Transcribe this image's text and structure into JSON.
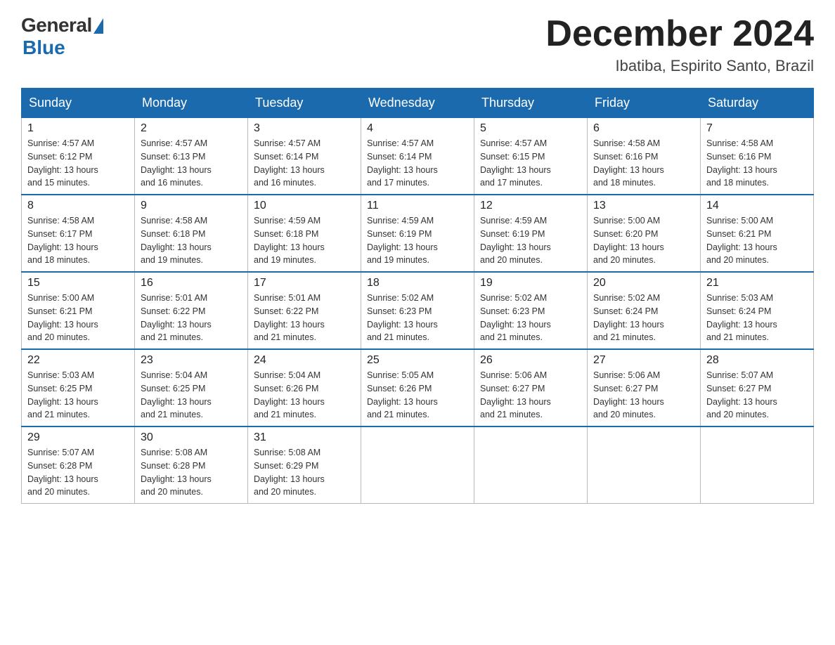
{
  "header": {
    "logo_general": "General",
    "logo_blue": "Blue",
    "month_year": "December 2024",
    "location": "Ibatiba, Espirito Santo, Brazil"
  },
  "days_of_week": [
    "Sunday",
    "Monday",
    "Tuesday",
    "Wednesday",
    "Thursday",
    "Friday",
    "Saturday"
  ],
  "weeks": [
    [
      {
        "day": "1",
        "info": "Sunrise: 4:57 AM\nSunset: 6:12 PM\nDaylight: 13 hours\nand 15 minutes."
      },
      {
        "day": "2",
        "info": "Sunrise: 4:57 AM\nSunset: 6:13 PM\nDaylight: 13 hours\nand 16 minutes."
      },
      {
        "day": "3",
        "info": "Sunrise: 4:57 AM\nSunset: 6:14 PM\nDaylight: 13 hours\nand 16 minutes."
      },
      {
        "day": "4",
        "info": "Sunrise: 4:57 AM\nSunset: 6:14 PM\nDaylight: 13 hours\nand 17 minutes."
      },
      {
        "day": "5",
        "info": "Sunrise: 4:57 AM\nSunset: 6:15 PM\nDaylight: 13 hours\nand 17 minutes."
      },
      {
        "day": "6",
        "info": "Sunrise: 4:58 AM\nSunset: 6:16 PM\nDaylight: 13 hours\nand 18 minutes."
      },
      {
        "day": "7",
        "info": "Sunrise: 4:58 AM\nSunset: 6:16 PM\nDaylight: 13 hours\nand 18 minutes."
      }
    ],
    [
      {
        "day": "8",
        "info": "Sunrise: 4:58 AM\nSunset: 6:17 PM\nDaylight: 13 hours\nand 18 minutes."
      },
      {
        "day": "9",
        "info": "Sunrise: 4:58 AM\nSunset: 6:18 PM\nDaylight: 13 hours\nand 19 minutes."
      },
      {
        "day": "10",
        "info": "Sunrise: 4:59 AM\nSunset: 6:18 PM\nDaylight: 13 hours\nand 19 minutes."
      },
      {
        "day": "11",
        "info": "Sunrise: 4:59 AM\nSunset: 6:19 PM\nDaylight: 13 hours\nand 19 minutes."
      },
      {
        "day": "12",
        "info": "Sunrise: 4:59 AM\nSunset: 6:19 PM\nDaylight: 13 hours\nand 20 minutes."
      },
      {
        "day": "13",
        "info": "Sunrise: 5:00 AM\nSunset: 6:20 PM\nDaylight: 13 hours\nand 20 minutes."
      },
      {
        "day": "14",
        "info": "Sunrise: 5:00 AM\nSunset: 6:21 PM\nDaylight: 13 hours\nand 20 minutes."
      }
    ],
    [
      {
        "day": "15",
        "info": "Sunrise: 5:00 AM\nSunset: 6:21 PM\nDaylight: 13 hours\nand 20 minutes."
      },
      {
        "day": "16",
        "info": "Sunrise: 5:01 AM\nSunset: 6:22 PM\nDaylight: 13 hours\nand 21 minutes."
      },
      {
        "day": "17",
        "info": "Sunrise: 5:01 AM\nSunset: 6:22 PM\nDaylight: 13 hours\nand 21 minutes."
      },
      {
        "day": "18",
        "info": "Sunrise: 5:02 AM\nSunset: 6:23 PM\nDaylight: 13 hours\nand 21 minutes."
      },
      {
        "day": "19",
        "info": "Sunrise: 5:02 AM\nSunset: 6:23 PM\nDaylight: 13 hours\nand 21 minutes."
      },
      {
        "day": "20",
        "info": "Sunrise: 5:02 AM\nSunset: 6:24 PM\nDaylight: 13 hours\nand 21 minutes."
      },
      {
        "day": "21",
        "info": "Sunrise: 5:03 AM\nSunset: 6:24 PM\nDaylight: 13 hours\nand 21 minutes."
      }
    ],
    [
      {
        "day": "22",
        "info": "Sunrise: 5:03 AM\nSunset: 6:25 PM\nDaylight: 13 hours\nand 21 minutes."
      },
      {
        "day": "23",
        "info": "Sunrise: 5:04 AM\nSunset: 6:25 PM\nDaylight: 13 hours\nand 21 minutes."
      },
      {
        "day": "24",
        "info": "Sunrise: 5:04 AM\nSunset: 6:26 PM\nDaylight: 13 hours\nand 21 minutes."
      },
      {
        "day": "25",
        "info": "Sunrise: 5:05 AM\nSunset: 6:26 PM\nDaylight: 13 hours\nand 21 minutes."
      },
      {
        "day": "26",
        "info": "Sunrise: 5:06 AM\nSunset: 6:27 PM\nDaylight: 13 hours\nand 21 minutes."
      },
      {
        "day": "27",
        "info": "Sunrise: 5:06 AM\nSunset: 6:27 PM\nDaylight: 13 hours\nand 20 minutes."
      },
      {
        "day": "28",
        "info": "Sunrise: 5:07 AM\nSunset: 6:27 PM\nDaylight: 13 hours\nand 20 minutes."
      }
    ],
    [
      {
        "day": "29",
        "info": "Sunrise: 5:07 AM\nSunset: 6:28 PM\nDaylight: 13 hours\nand 20 minutes."
      },
      {
        "day": "30",
        "info": "Sunrise: 5:08 AM\nSunset: 6:28 PM\nDaylight: 13 hours\nand 20 minutes."
      },
      {
        "day": "31",
        "info": "Sunrise: 5:08 AM\nSunset: 6:29 PM\nDaylight: 13 hours\nand 20 minutes."
      },
      {
        "day": "",
        "info": ""
      },
      {
        "day": "",
        "info": ""
      },
      {
        "day": "",
        "info": ""
      },
      {
        "day": "",
        "info": ""
      }
    ]
  ]
}
